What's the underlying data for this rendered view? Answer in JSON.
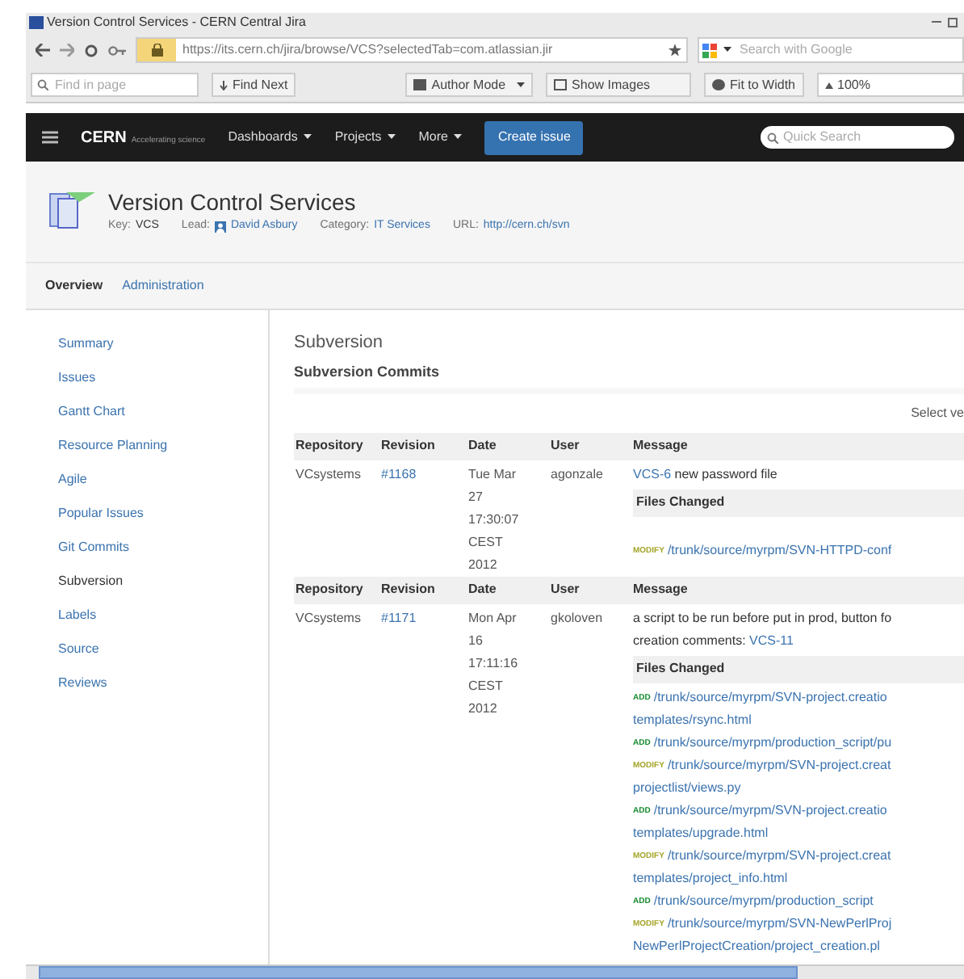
{
  "browser": {
    "title": "Version Control Services - CERN Central Jira",
    "url": "https://its.cern.ch/jira/browse/VCS?selectedTab=com.atlassian.jir",
    "search_placeholder": "Search with Google",
    "find_placeholder": "Find in page",
    "find_next": "Find Next",
    "author_mode": "Author Mode",
    "show_images": "Show Images",
    "fit_to_width": "Fit to Width",
    "zoom": "100%"
  },
  "jira_nav": {
    "brand": "CERN",
    "brand_sub": "Accelerating science",
    "menus": [
      "Dashboards",
      "Projects",
      "More"
    ],
    "create": "Create issue",
    "quick_search_placeholder": "Quick Search"
  },
  "project": {
    "title": "Version Control Services",
    "key_label": "Key:",
    "key": "VCS",
    "lead_label": "Lead:",
    "lead": "David Asbury",
    "category_label": "Category:",
    "category": "IT Services",
    "url_label": "URL:",
    "url": "http://cern.ch/svn"
  },
  "tabs": [
    {
      "label": "Overview",
      "selected": true
    },
    {
      "label": "Administration",
      "selected": false
    }
  ],
  "sidebar": [
    {
      "label": "Summary",
      "selected": false
    },
    {
      "label": "Issues",
      "selected": false
    },
    {
      "label": "Gantt Chart",
      "selected": false
    },
    {
      "label": "Resource Planning",
      "selected": false
    },
    {
      "label": "Agile",
      "selected": false
    },
    {
      "label": "Popular Issues",
      "selected": false
    },
    {
      "label": "Git Commits",
      "selected": false
    },
    {
      "label": "Subversion",
      "selected": true
    },
    {
      "label": "Labels",
      "selected": false
    },
    {
      "label": "Source",
      "selected": false
    },
    {
      "label": "Reviews",
      "selected": false
    }
  ],
  "section_title": "Subversion",
  "subsection_title": "Subversion Commits",
  "select_label": "Select ve",
  "commits": [
    {
      "columns": [
        "Repository",
        "Revision",
        "Date",
        "User",
        "Message"
      ],
      "repository": "VCsystems",
      "revision": "#1168",
      "date_lines": [
        "Tue Mar",
        "27",
        "17:30:07",
        "CEST",
        "2012"
      ],
      "user": "agonzale",
      "message": [
        [
          {
            "text": "VCS-6",
            "link": true
          },
          {
            "text": " new password file",
            "link": false
          }
        ]
      ],
      "files_label": "Files Changed",
      "files": [
        {
          "kind": "modify",
          "action": "MODIFY",
          "lines": [
            "/trunk/source/myrpm/SVN-HTTPD-conf"
          ]
        }
      ]
    },
    {
      "columns": [
        "Repository",
        "Revision",
        "Date",
        "User",
        "Message"
      ],
      "repository": "VCsystems",
      "revision": "#1171",
      "date_lines": [
        "Mon Apr",
        "16",
        "17:11:16",
        "CEST",
        "2012"
      ],
      "user": "gkoloven",
      "message": [
        [
          {
            "text": "a script to be run before put in prod, button fo",
            "link": false
          }
        ],
        [
          {
            "text": "creation comments: ",
            "link": false
          },
          {
            "text": "VCS-11",
            "link": true
          }
        ]
      ],
      "files_label": "Files Changed",
      "files": [
        {
          "kind": "add",
          "action": "ADD",
          "lines": [
            "/trunk/source/myrpm/SVN-project.creatio",
            "templates/rsync.html"
          ]
        },
        {
          "kind": "add",
          "action": "ADD",
          "lines": [
            "/trunk/source/myrpm/production_script/pu"
          ]
        },
        {
          "kind": "modify",
          "action": "MODIFY",
          "lines": [
            "/trunk/source/myrpm/SVN-project.creat",
            "projectlist/views.py"
          ]
        },
        {
          "kind": "add",
          "action": "ADD",
          "lines": [
            "/trunk/source/myrpm/SVN-project.creatio",
            "templates/upgrade.html"
          ]
        },
        {
          "kind": "modify",
          "action": "MODIFY",
          "lines": [
            "/trunk/source/myrpm/SVN-project.creat",
            "templates/project_info.html"
          ]
        },
        {
          "kind": "add",
          "action": "ADD",
          "lines": [
            "/trunk/source/myrpm/production_script"
          ]
        },
        {
          "kind": "modify",
          "action": "MODIFY",
          "lines": [
            "/trunk/source/myrpm/SVN-NewPerlProj",
            "NewPerlProjectCreation/project_creation.pl"
          ]
        }
      ]
    }
  ]
}
